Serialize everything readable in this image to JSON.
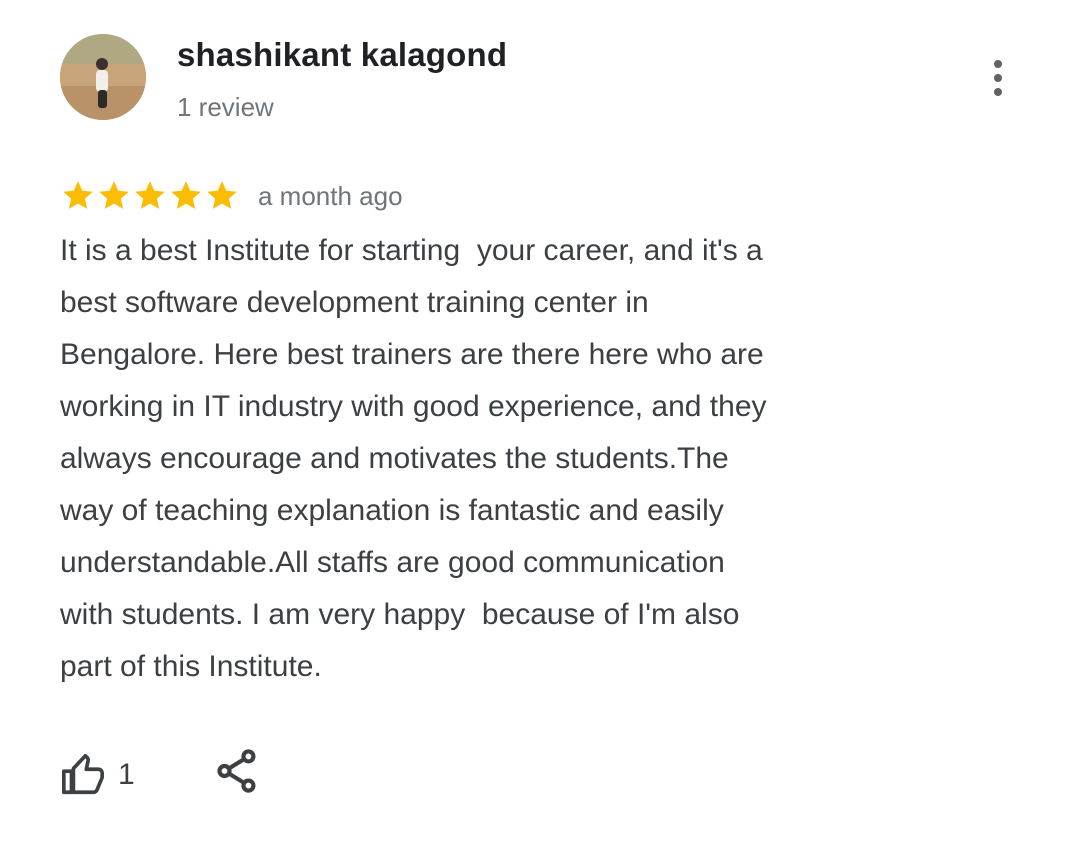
{
  "reviewer": {
    "name": "shashikant kalagond",
    "review_count": "1 review",
    "avatar_icon": "user-photo-avatar"
  },
  "review": {
    "rating": 5,
    "rating_max": 5,
    "star_color": "#fbbc04",
    "date": "a month ago",
    "text_lines": [
      "It is a best Institute for starting  your career, and it's a",
      "best software development training center in",
      "Bengalore. Here best trainers are there here who are",
      "working in IT industry with good experience, and they",
      "always encourage and motivates the students.The",
      "way of teaching explanation is fantastic and easily",
      "understandable.All staffs are good communication",
      "with students. I am very happy  because of I'm also",
      "part of this Institute."
    ]
  },
  "actions": {
    "like_icon": "thumbs-up-icon",
    "like_count": "1",
    "share_icon": "share-icon",
    "more_icon": "more-vert-icon"
  },
  "colors": {
    "name": "#202124",
    "secondary": "#70757a",
    "body": "#3c4043",
    "icon": "#3c4043"
  }
}
